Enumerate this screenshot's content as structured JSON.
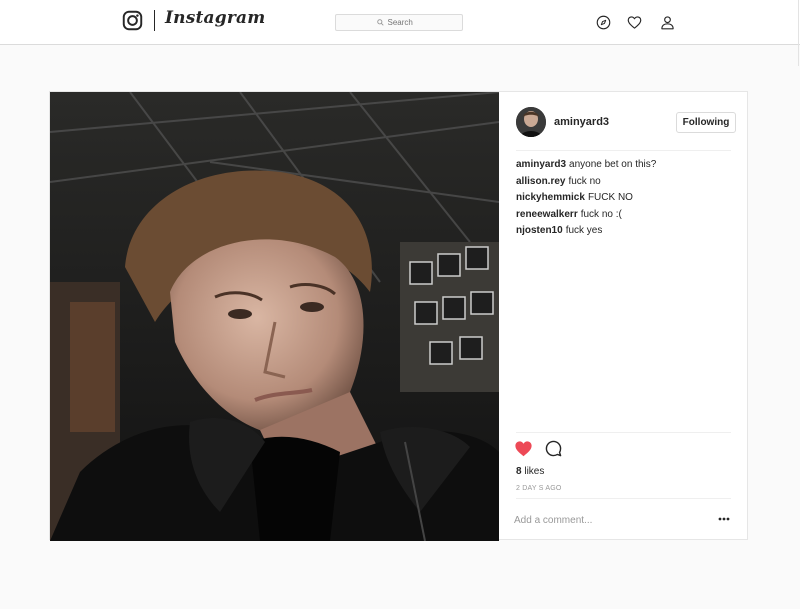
{
  "header": {
    "brand": "Instagram",
    "search_placeholder": "Search",
    "icons": [
      "instagram-camera-icon",
      "search-icon",
      "compass-icon",
      "heart-icon",
      "profile-icon"
    ]
  },
  "post": {
    "author": "aminyard3",
    "follow_label": "Following",
    "comments": [
      {
        "user": "aminyard3",
        "text": "anyone bet on this?"
      },
      {
        "user": "allison.rey",
        "text": "fuck no"
      },
      {
        "user": "nickyhemmick",
        "text": "FUCK NO"
      },
      {
        "user": "reneewalkerr",
        "text": "fuck no :("
      },
      {
        "user": "njosten10",
        "text": "fuck yes"
      }
    ],
    "likes_count": "8",
    "likes_label": "likes",
    "timestamp": "2 DAY S AGO",
    "add_comment_placeholder": "Add a comment...",
    "liked": true
  },
  "colors": {
    "like": "#ed4956",
    "text": "#262626",
    "muted": "#999999",
    "border": "#dbdbdb"
  }
}
